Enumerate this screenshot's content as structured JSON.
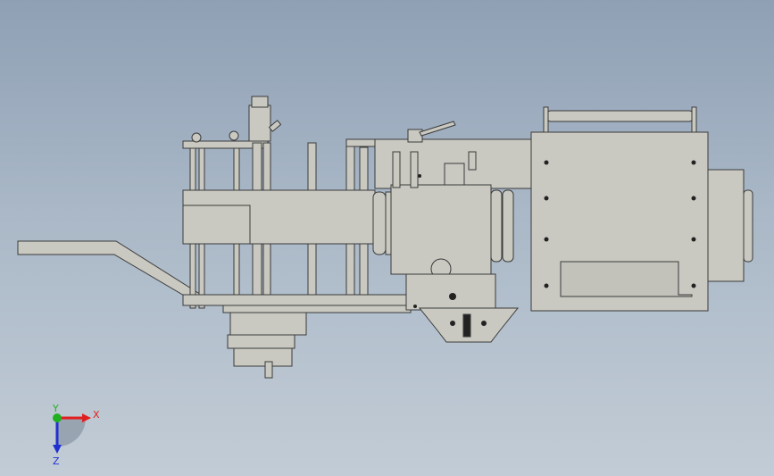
{
  "viewport": {
    "background_top": "#8fa0b5",
    "background_bottom": "#c2ccd6",
    "part_fill": "#c9c9c1",
    "part_stroke": "#3a3a3a"
  },
  "triad": {
    "x_label": "X",
    "y_label": "Y",
    "z_label": "Z",
    "x_color": "#e02020",
    "y_color": "#20b020",
    "z_color": "#2030d0"
  }
}
